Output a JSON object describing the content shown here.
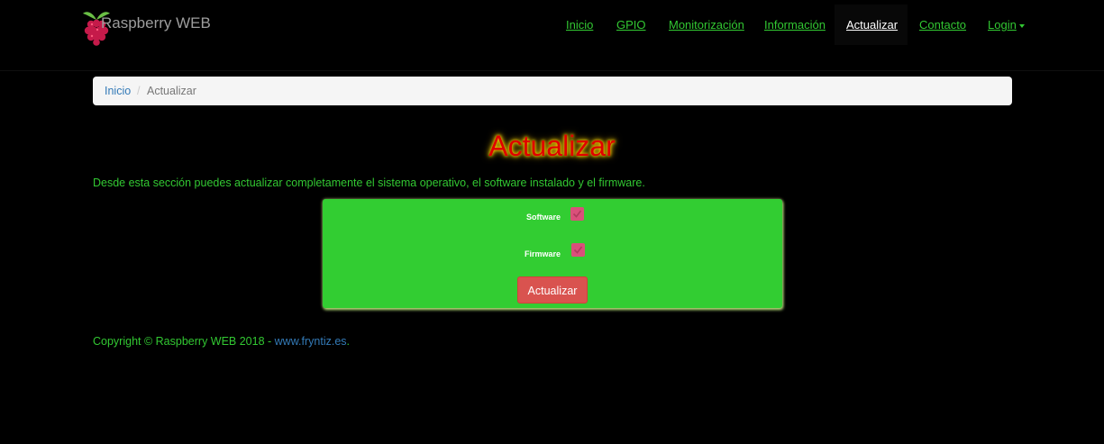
{
  "brand": {
    "title": "Raspberry WEB",
    "logo_icon": "raspberry-logo-icon"
  },
  "nav": {
    "items": [
      {
        "label": "Inicio",
        "active": false
      },
      {
        "label": "GPIO",
        "active": false
      },
      {
        "label": "Monitorización",
        "active": false
      },
      {
        "label": "Información",
        "active": false
      },
      {
        "label": "Actualizar",
        "active": true
      },
      {
        "label": "Contacto",
        "active": false
      },
      {
        "label": "Login",
        "active": false,
        "dropdown": true
      }
    ]
  },
  "breadcrumb": {
    "home": "Inicio",
    "separator": "/",
    "current": "Actualizar"
  },
  "page": {
    "title": "Actualizar",
    "intro": "Desde esta sección puedes actualizar completamente el sistema operativo, el software instalado y el firmware."
  },
  "form": {
    "software_label": "Software",
    "software_checked": true,
    "firmware_label": "Firmware",
    "firmware_checked": true,
    "submit_label": "Actualizar"
  },
  "footer": {
    "text": "Copyright © Raspberry WEB 2018 - ",
    "link": "www.fryntiz.es",
    "suffix": "."
  },
  "colors": {
    "background": "#000000",
    "accent_green": "#32c832",
    "panel_green": "#32cd32",
    "button_red": "#d9534f",
    "checkbox_pink": "#d9507a",
    "title_red": "#e00000",
    "title_glow": "#ffd400",
    "link_blue": "#337ab7"
  }
}
